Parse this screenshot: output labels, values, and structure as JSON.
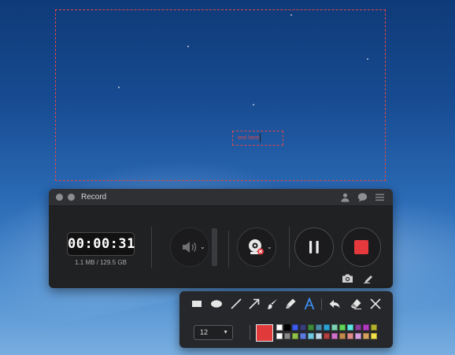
{
  "window": {
    "title": "Record"
  },
  "recording": {
    "elapsed": "00:00:31",
    "file_info": "1.1 MB / 129.5 GB"
  },
  "text_annotation": {
    "value": "text here"
  },
  "annotation_toolbar": {
    "tools": [
      "rectangle",
      "ellipse",
      "line",
      "arrow",
      "brush",
      "highlighter",
      "text",
      "undo",
      "eraser",
      "close"
    ],
    "font_size": "12",
    "current_color": "#e03a3a",
    "palette": [
      "#ffffff",
      "#000000",
      "#3d5af1",
      "#3a3f7c",
      "#3f8a3a",
      "#4a8aa8",
      "#2aa3d6",
      "#7ad0b0",
      "#62d455",
      "#5de5e0",
      "#8a3f9a",
      "#b33ac0",
      "#b0b02a",
      "#ffffff",
      "#8a8a8a",
      "#8fc04a",
      "#5a7ae0",
      "#6fc8e0",
      "#c0d8e8",
      "#b34040",
      "#d070c8",
      "#c08a4a",
      "#e08a8a",
      "#d4a0e0",
      "#d4a060",
      "#f0e04a"
    ]
  },
  "colors": {
    "accent_record": "#e5393d",
    "capture_border": "#e04848"
  }
}
